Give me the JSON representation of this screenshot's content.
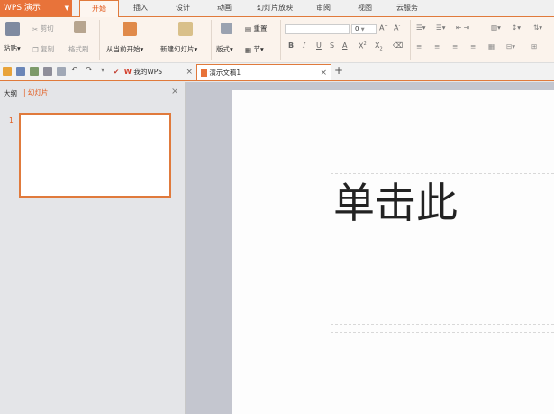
{
  "app": {
    "name": "WPS 演示",
    "accent": "#e8733a"
  },
  "menu": {
    "tabs": [
      {
        "label": "开始",
        "active": true
      },
      {
        "label": "插入"
      },
      {
        "label": "设计"
      },
      {
        "label": "动画"
      },
      {
        "label": "幻灯片放映"
      },
      {
        "label": "审阅"
      },
      {
        "label": "视图"
      },
      {
        "label": "云服务"
      }
    ]
  },
  "ribbon": {
    "paste": "粘贴",
    "cut": "剪切",
    "copy": "复制",
    "format_painter": "格式刷",
    "from_current": "从当前开始",
    "new_slide": "新建幻灯片",
    "layout": "版式",
    "reset": "重置",
    "section": "节",
    "font_size": "0"
  },
  "quickbar": {
    "tabs": [
      {
        "label": "我的WPS"
      },
      {
        "label": "演示文稿1",
        "active": true
      }
    ],
    "add_tab": "+"
  },
  "left_panel": {
    "tabs": [
      {
        "label": "大纲"
      },
      {
        "label": "幻灯片",
        "active": true
      }
    ],
    "slides": [
      {
        "number": "1"
      }
    ]
  },
  "slide": {
    "title_placeholder": "单击此"
  }
}
